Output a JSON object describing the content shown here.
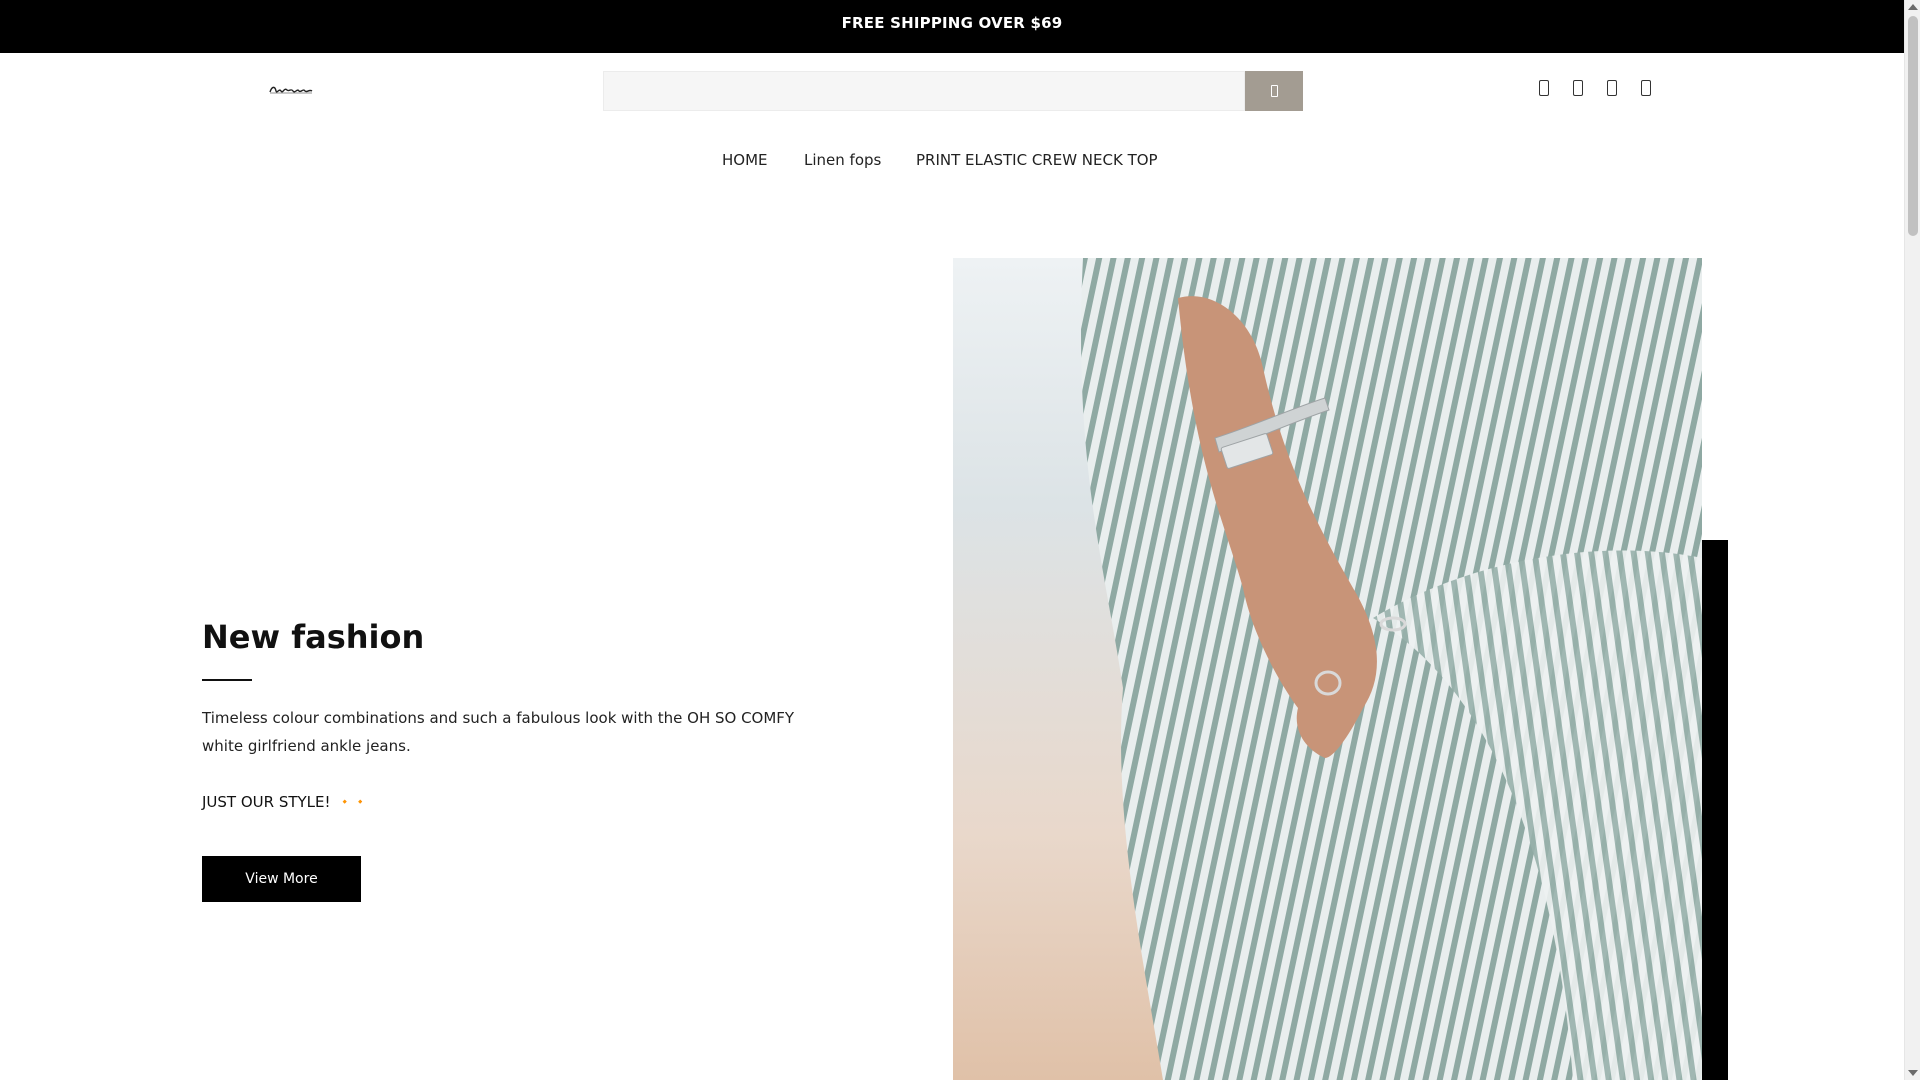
{
  "announcement": {
    "text": "FREE SHIPPING OVER $69"
  },
  "header": {
    "logo_text": "Erlen",
    "search": {
      "placeholder": "",
      "value": ""
    },
    "icons": [
      "user-icon",
      "heart-icon",
      "bag-icon",
      "cart-icon"
    ]
  },
  "nav": {
    "items": [
      {
        "label": "HOME"
      },
      {
        "label": "Linen fops"
      },
      {
        "label": "PRINT ELASTIC CREW NECK TOP"
      }
    ]
  },
  "hero": {
    "title": "New fashion",
    "description": "Timeless colour combinations and such a fabulous look with the OH SO COMFY white girlfriend ankle jeans.",
    "tagline": "JUST OUR STYLE!",
    "sparkles": "🔸 🔸",
    "button_label": "View More"
  },
  "colors": {
    "announcement_bg": "#000000",
    "search_button": "#a39c92",
    "cta_bg": "#000000",
    "sparkle": "#f08c1c"
  }
}
